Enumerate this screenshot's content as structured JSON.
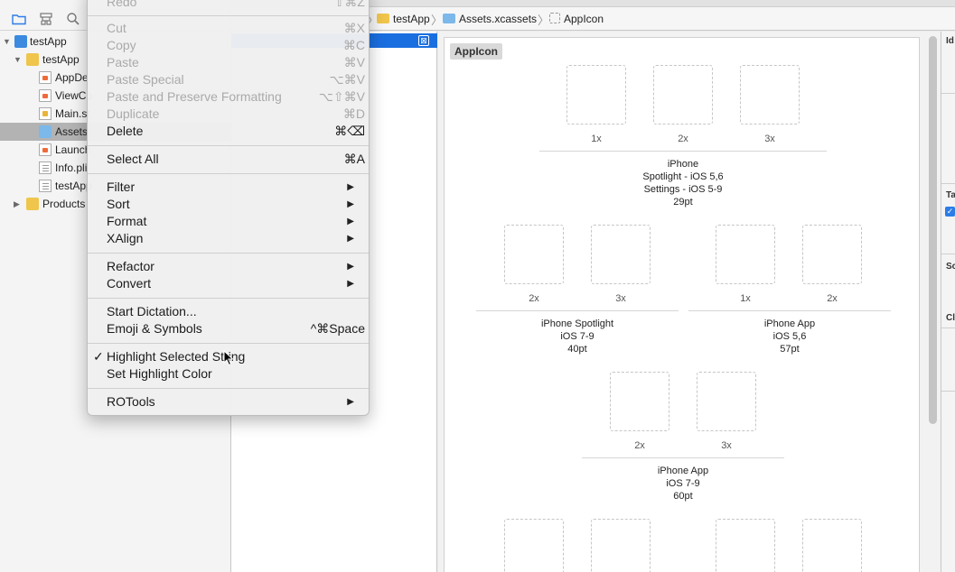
{
  "navigator": {
    "items": [
      {
        "label": "testApp",
        "kind": "proj"
      },
      {
        "label": "testApp",
        "kind": "folder"
      },
      {
        "label": "AppDe",
        "kind": "swift"
      },
      {
        "label": "ViewCo",
        "kind": "swift"
      },
      {
        "label": "Main.st",
        "kind": "sb"
      },
      {
        "label": "Assets",
        "kind": "asset",
        "selected": true
      },
      {
        "label": "Launch",
        "kind": "swift"
      },
      {
        "label": "Info.pli",
        "kind": "plist"
      },
      {
        "label": "testApp",
        "kind": "plist"
      },
      {
        "label": "Products",
        "kind": "folder"
      }
    ]
  },
  "jump_bar": {
    "crumbs": [
      "testApp",
      "Assets.xcassets",
      "AppIcon"
    ]
  },
  "asset_set": {
    "title": "AppIcon",
    "groups": [
      {
        "scales": [
          "1x",
          "2x",
          "3x"
        ],
        "caption": [
          "iPhone",
          "Spotlight - iOS 5,6",
          "Settings - iOS 5-9",
          "29pt"
        ]
      },
      {
        "scales": [
          "2x",
          "3x"
        ],
        "caption": [
          "iPhone Spotlight",
          "iOS 7-9",
          "40pt"
        ]
      },
      {
        "scales": [
          "1x",
          "2x"
        ],
        "caption": [
          "iPhone App",
          "iOS 5,6",
          "57pt"
        ]
      },
      {
        "scales": [
          "2x",
          "3x"
        ],
        "caption": [
          "iPhone App",
          "iOS 7-9",
          "60pt"
        ]
      }
    ]
  },
  "inspector": {
    "labels": [
      "Id",
      "Ta",
      "Sc",
      "Cl"
    ]
  },
  "context_menu": {
    "redo": {
      "label": "Redo",
      "shortcut": "⇧⌘Z"
    },
    "cut": {
      "label": "Cut",
      "shortcut": "⌘X"
    },
    "copy": {
      "label": "Copy",
      "shortcut": "⌘C"
    },
    "paste": {
      "label": "Paste",
      "shortcut": "⌘V"
    },
    "paste_special": {
      "label": "Paste Special",
      "shortcut": "⌥⌘V"
    },
    "paste_preserve": {
      "label": "Paste and Preserve Formatting",
      "shortcut": "⌥⇧⌘V"
    },
    "duplicate": {
      "label": "Duplicate",
      "shortcut": "⌘D"
    },
    "delete": {
      "label": "Delete",
      "shortcut": "⌘⌫"
    },
    "select_all": {
      "label": "Select All",
      "shortcut": "⌘A"
    },
    "filter": {
      "label": "Filter"
    },
    "sort": {
      "label": "Sort"
    },
    "format": {
      "label": "Format"
    },
    "xalign": {
      "label": "XAlign"
    },
    "refactor": {
      "label": "Refactor"
    },
    "convert": {
      "label": "Convert"
    },
    "start_dictation": {
      "label": "Start Dictation..."
    },
    "emoji": {
      "label": "Emoji & Symbols",
      "shortcut": "^⌘Space"
    },
    "highlight_selected": {
      "label": "Highlight Selected String",
      "checked": "✓"
    },
    "set_highlight_color": {
      "label": "Set Highlight Color"
    },
    "rotools": {
      "label": "ROTools"
    }
  }
}
